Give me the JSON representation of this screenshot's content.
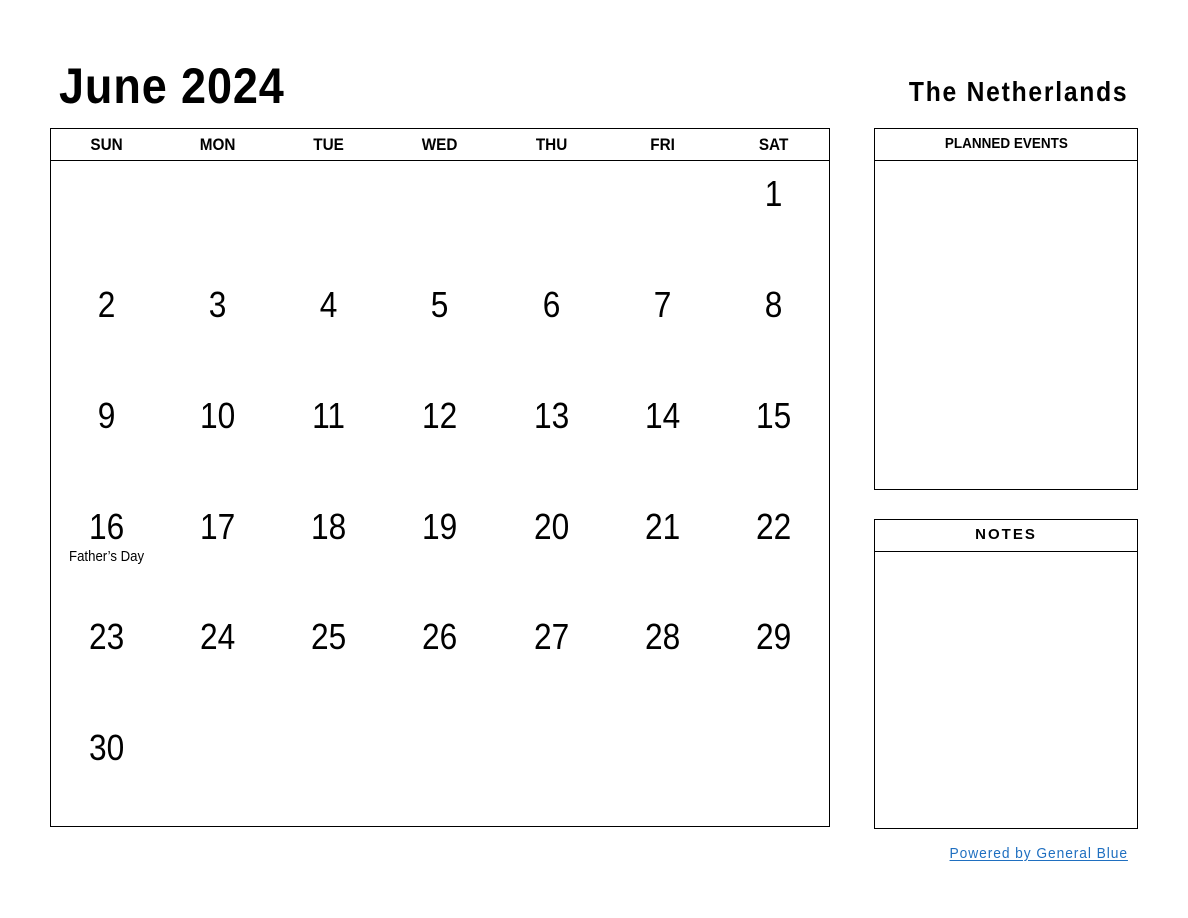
{
  "header": {
    "title": "June 2024",
    "country": "The Netherlands"
  },
  "calendar": {
    "weekdays": [
      "SUN",
      "MON",
      "TUE",
      "WED",
      "THU",
      "FRI",
      "SAT"
    ],
    "weeks": [
      [
        {
          "day": ""
        },
        {
          "day": ""
        },
        {
          "day": ""
        },
        {
          "day": ""
        },
        {
          "day": ""
        },
        {
          "day": ""
        },
        {
          "day": "1"
        }
      ],
      [
        {
          "day": "2"
        },
        {
          "day": "3"
        },
        {
          "day": "4"
        },
        {
          "day": "5"
        },
        {
          "day": "6"
        },
        {
          "day": "7"
        },
        {
          "day": "8"
        }
      ],
      [
        {
          "day": "9"
        },
        {
          "day": "10"
        },
        {
          "day": "11"
        },
        {
          "day": "12"
        },
        {
          "day": "13"
        },
        {
          "day": "14"
        },
        {
          "day": "15"
        }
      ],
      [
        {
          "day": "16",
          "holiday": "Father’s Day"
        },
        {
          "day": "17"
        },
        {
          "day": "18"
        },
        {
          "day": "19"
        },
        {
          "day": "20"
        },
        {
          "day": "21"
        },
        {
          "day": "22"
        }
      ],
      [
        {
          "day": "23"
        },
        {
          "day": "24"
        },
        {
          "day": "25"
        },
        {
          "day": "26"
        },
        {
          "day": "27"
        },
        {
          "day": "28"
        },
        {
          "day": "29"
        }
      ],
      [
        {
          "day": "30"
        },
        {
          "day": ""
        },
        {
          "day": ""
        },
        {
          "day": ""
        },
        {
          "day": ""
        },
        {
          "day": ""
        },
        {
          "day": ""
        }
      ]
    ]
  },
  "panels": {
    "events_title": "PLANNED EVENTS",
    "notes_title": "NOTES"
  },
  "footer": {
    "link_text": "Powered by General Blue",
    "link_color": "#1f6fc0"
  }
}
